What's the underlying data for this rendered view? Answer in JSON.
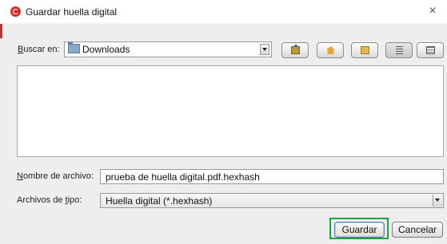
{
  "window": {
    "title": "Guardar huella digital",
    "close_symbol": "×"
  },
  "lookin": {
    "label_underlined": "B",
    "label_rest": "uscar en:",
    "folder": "Downloads"
  },
  "toolbar": {
    "icons": [
      "up-folder-icon",
      "home-icon",
      "new-folder-icon",
      "list-view-icon",
      "details-view-icon"
    ]
  },
  "filename": {
    "label_underlined": "N",
    "label_rest": "ombre de archivo:",
    "value": "prueba de huella digital.pdf.hexhash"
  },
  "filetype": {
    "label_before": "Archivos de ",
    "label_underlined": "t",
    "label_after": "ipo:",
    "value": "Huella digital (*.hexhash)"
  },
  "buttons": {
    "save": "Guardar",
    "cancel": "Cancelar"
  },
  "colors": {
    "highlight": "#1aa33a",
    "app_icon": "#d0312d"
  }
}
